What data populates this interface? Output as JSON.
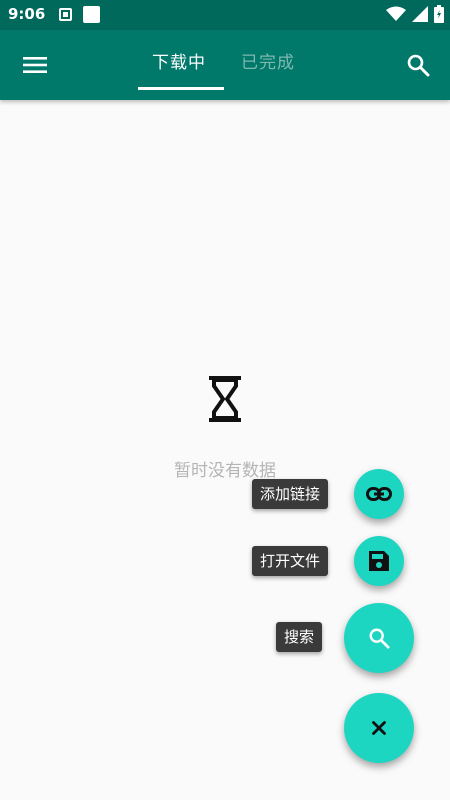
{
  "status_bar": {
    "time": "9:06",
    "icons": [
      "notification-a-icon",
      "notification-b-icon",
      "wifi-icon",
      "signal-icon",
      "battery-icon"
    ]
  },
  "app_bar": {
    "tabs": [
      {
        "label": "下载中",
        "active": true
      },
      {
        "label": "已完成",
        "active": false
      }
    ],
    "menu_icon": "menu-icon",
    "search_icon": "search-icon",
    "colors": {
      "primary": "#00796b",
      "primary_dark": "#00695c",
      "accent": "#1dd6c1"
    }
  },
  "empty_state": {
    "icon": "hourglass-icon",
    "text": "暂时没有数据"
  },
  "speed_dial": {
    "actions": [
      {
        "label": "添加链接",
        "icon": "link-icon"
      },
      {
        "label": "打开文件",
        "icon": "save-icon"
      },
      {
        "label": "搜索",
        "icon": "search-icon"
      }
    ],
    "main_icon": "close-icon"
  }
}
